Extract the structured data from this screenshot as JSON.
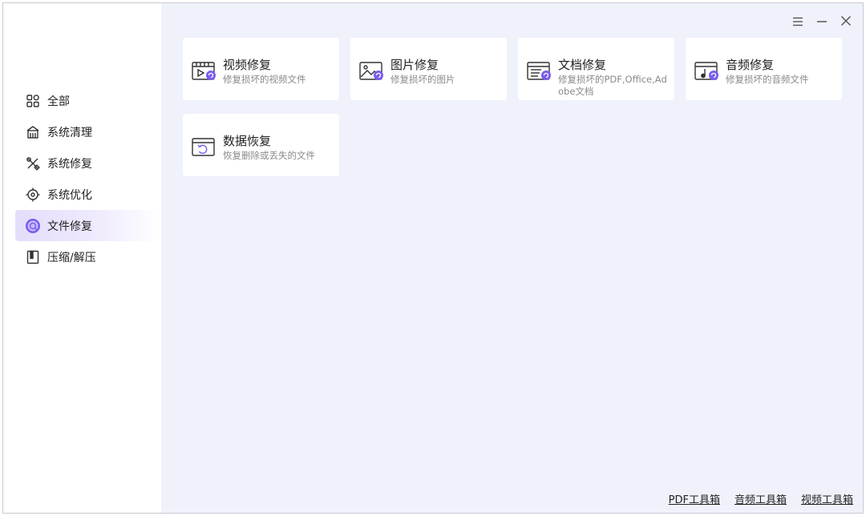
{
  "sidebar": {
    "items": [
      {
        "label": "全部",
        "icon": "grid-icon"
      },
      {
        "label": "系统清理",
        "icon": "broom-icon"
      },
      {
        "label": "系统修复",
        "icon": "wrench-icon"
      },
      {
        "label": "系统优化",
        "icon": "target-icon"
      },
      {
        "label": "文件修复",
        "icon": "file-repair-icon",
        "active": true
      },
      {
        "label": "压缩/解压",
        "icon": "archive-icon"
      }
    ]
  },
  "cards": [
    {
      "title": "视频修复",
      "desc": "修复损坏的视频文件",
      "icon": "video-repair-icon"
    },
    {
      "title": "图片修复",
      "desc": "修复损坏的图片",
      "icon": "image-repair-icon"
    },
    {
      "title": "文档修复",
      "desc": "修复损坏的PDF,Office,Adobe文档",
      "icon": "document-repair-icon"
    },
    {
      "title": "音频修复",
      "desc": "修复损坏的音频文件",
      "icon": "audio-repair-icon"
    },
    {
      "title": "数据恢复",
      "desc": "恢复删除或丢失的文件",
      "icon": "data-recovery-icon"
    }
  ],
  "footer": {
    "links": [
      "PDF工具箱",
      "音频工具箱",
      "视频工具箱"
    ]
  },
  "colors": {
    "accent": "#7b5cf0",
    "main_bg": "#eff2fb"
  }
}
